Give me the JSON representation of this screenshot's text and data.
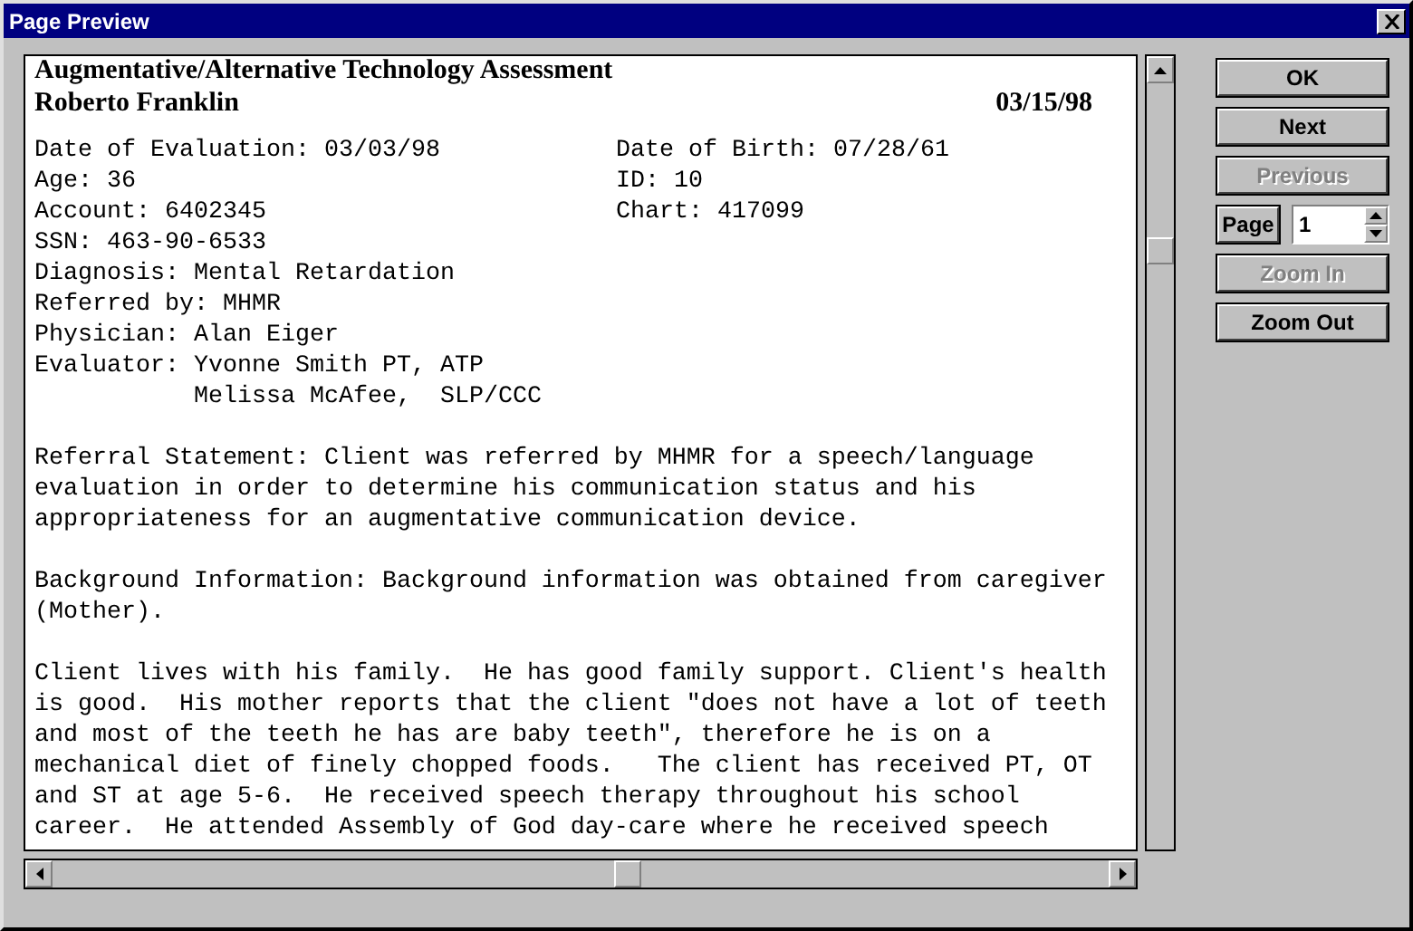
{
  "window": {
    "title": "Page Preview"
  },
  "document": {
    "heading": "Augmentative/Alternative Technology Assessment",
    "patient_name": "Roberto Franklin",
    "report_date": "03/15/98",
    "fields": [
      {
        "left": "Date of Evaluation: 03/03/98",
        "right": "Date of Birth: 07/28/61"
      },
      {
        "left": "Age: 36",
        "right": "ID: 10"
      },
      {
        "left": "Account: 6402345",
        "right": "Chart: 417099"
      },
      {
        "left": "SSN: 463-90-6533"
      },
      {
        "left": "Diagnosis: Mental Retardation"
      },
      {
        "left": "Referred by: MHMR"
      },
      {
        "left": "Physician: Alan Eiger"
      },
      {
        "left": "Evaluator: Yvonne Smith PT, ATP"
      },
      {
        "left": "           Melissa McAfee,  SLP/CCC"
      }
    ],
    "paragraphs": [
      "Referral Statement: Client was referred by MHMR for a speech/language evaluation in order to determine his communication status and his appropriateness for an augmentative communication device.",
      "Background Information: Background information was obtained from caregiver (Mother).",
      "Client lives with his family.  He has good family support. Client's health is good.  His mother reports that the client \"does not have a lot of teeth and most of the teeth he has are baby teeth\", therefore he is on a mechanical diet of finely chopped foods.   The client has received PT, OT and ST at age 5-6.  He received speech therapy throughout his school career.  He attended Assembly of God day-care where he received speech"
    ]
  },
  "buttons": [
    {
      "kind": "button",
      "label": "OK",
      "disabled": false
    },
    {
      "kind": "button",
      "label": "Next",
      "disabled": false
    },
    {
      "kind": "button",
      "label": "Previous",
      "disabled": true
    },
    {
      "kind": "page",
      "label": "Page",
      "value": "1",
      "disabled": false
    },
    {
      "kind": "button",
      "label": "Zoom In",
      "disabled": true
    },
    {
      "kind": "button",
      "label": "Zoom Out",
      "disabled": false
    }
  ]
}
